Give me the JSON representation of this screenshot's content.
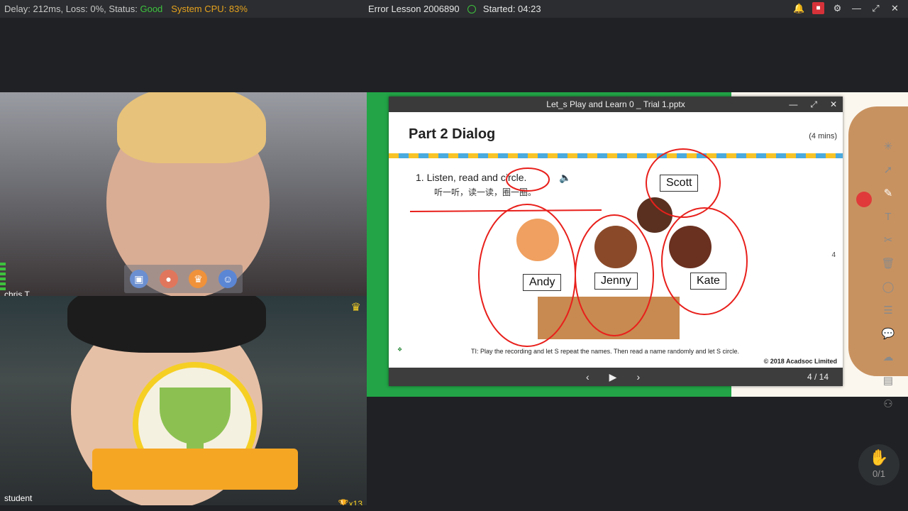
{
  "topbar": {
    "delay": "Delay: 212ms, Loss: 0%, Status: ",
    "status": "Good",
    "cpu": "System CPU: 83%",
    "lesson": "Error Lesson 2006890",
    "started": "Started: 04:23"
  },
  "teacher": {
    "name": "chris T"
  },
  "student": {
    "name": "student",
    "trophies": "🏆x13"
  },
  "ppt": {
    "filename": "Let_s Play and Learn 0 _ Trial 1.pptx",
    "slide": {
      "title": "Part 2 Dialog",
      "mins": "(4 mins)",
      "instruction": "1.  Listen, read and circle.",
      "instruction_cn": "听一听，读一读，圈一圈。",
      "names": [
        "Scott",
        "Andy",
        "Jenny",
        "Kate"
      ],
      "note": "TI: Play the recording and let S repeat the names. Then read a name randomly and let S circle.",
      "copyright": "© 2018 Acadsoc Limited",
      "page_marker": "4"
    },
    "pager": "4 / 14"
  },
  "raise_hand": {
    "count": "0/1"
  }
}
